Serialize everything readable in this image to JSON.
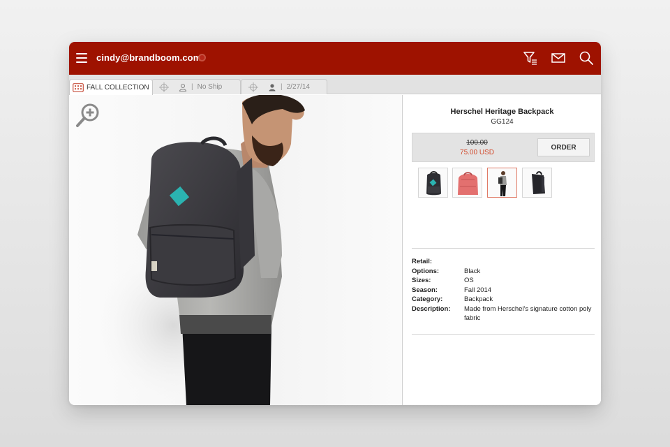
{
  "header": {
    "user_email": "cindy@brandboom.com"
  },
  "tabs": [
    {
      "label": "FALL COLLECTION",
      "active": true
    },
    {
      "label": "No Ship",
      "active": false
    },
    {
      "label": "2/27/14",
      "active": false
    }
  ],
  "product": {
    "name": "Herschel Heritage Backpack",
    "code": "GG124",
    "old_price": "100.00",
    "new_price": "75.00 USD",
    "order_label": "ORDER",
    "thumbnails": [
      {
        "icon": "backpack-front-thumbnail"
      },
      {
        "icon": "backpack-pink-thumbnail"
      },
      {
        "icon": "model-thumbnail",
        "selected": true
      },
      {
        "icon": "backpack-side-thumbnail"
      }
    ],
    "attributes": [
      {
        "key": "Retail:",
        "value": ""
      },
      {
        "key": "Options:",
        "value": "Black"
      },
      {
        "key": "Sizes:",
        "value": "OS"
      },
      {
        "key": "Season:",
        "value": "Fall 2014"
      },
      {
        "key": "Category:",
        "value": "Backpack"
      },
      {
        "key": "Description:",
        "value": "Made from Herschel's signature cotton poly fabric"
      }
    ]
  },
  "colors": {
    "brand": "#9e1200",
    "sale_price": "#d24a2c",
    "backpack_tag": "#2bb3b0"
  }
}
